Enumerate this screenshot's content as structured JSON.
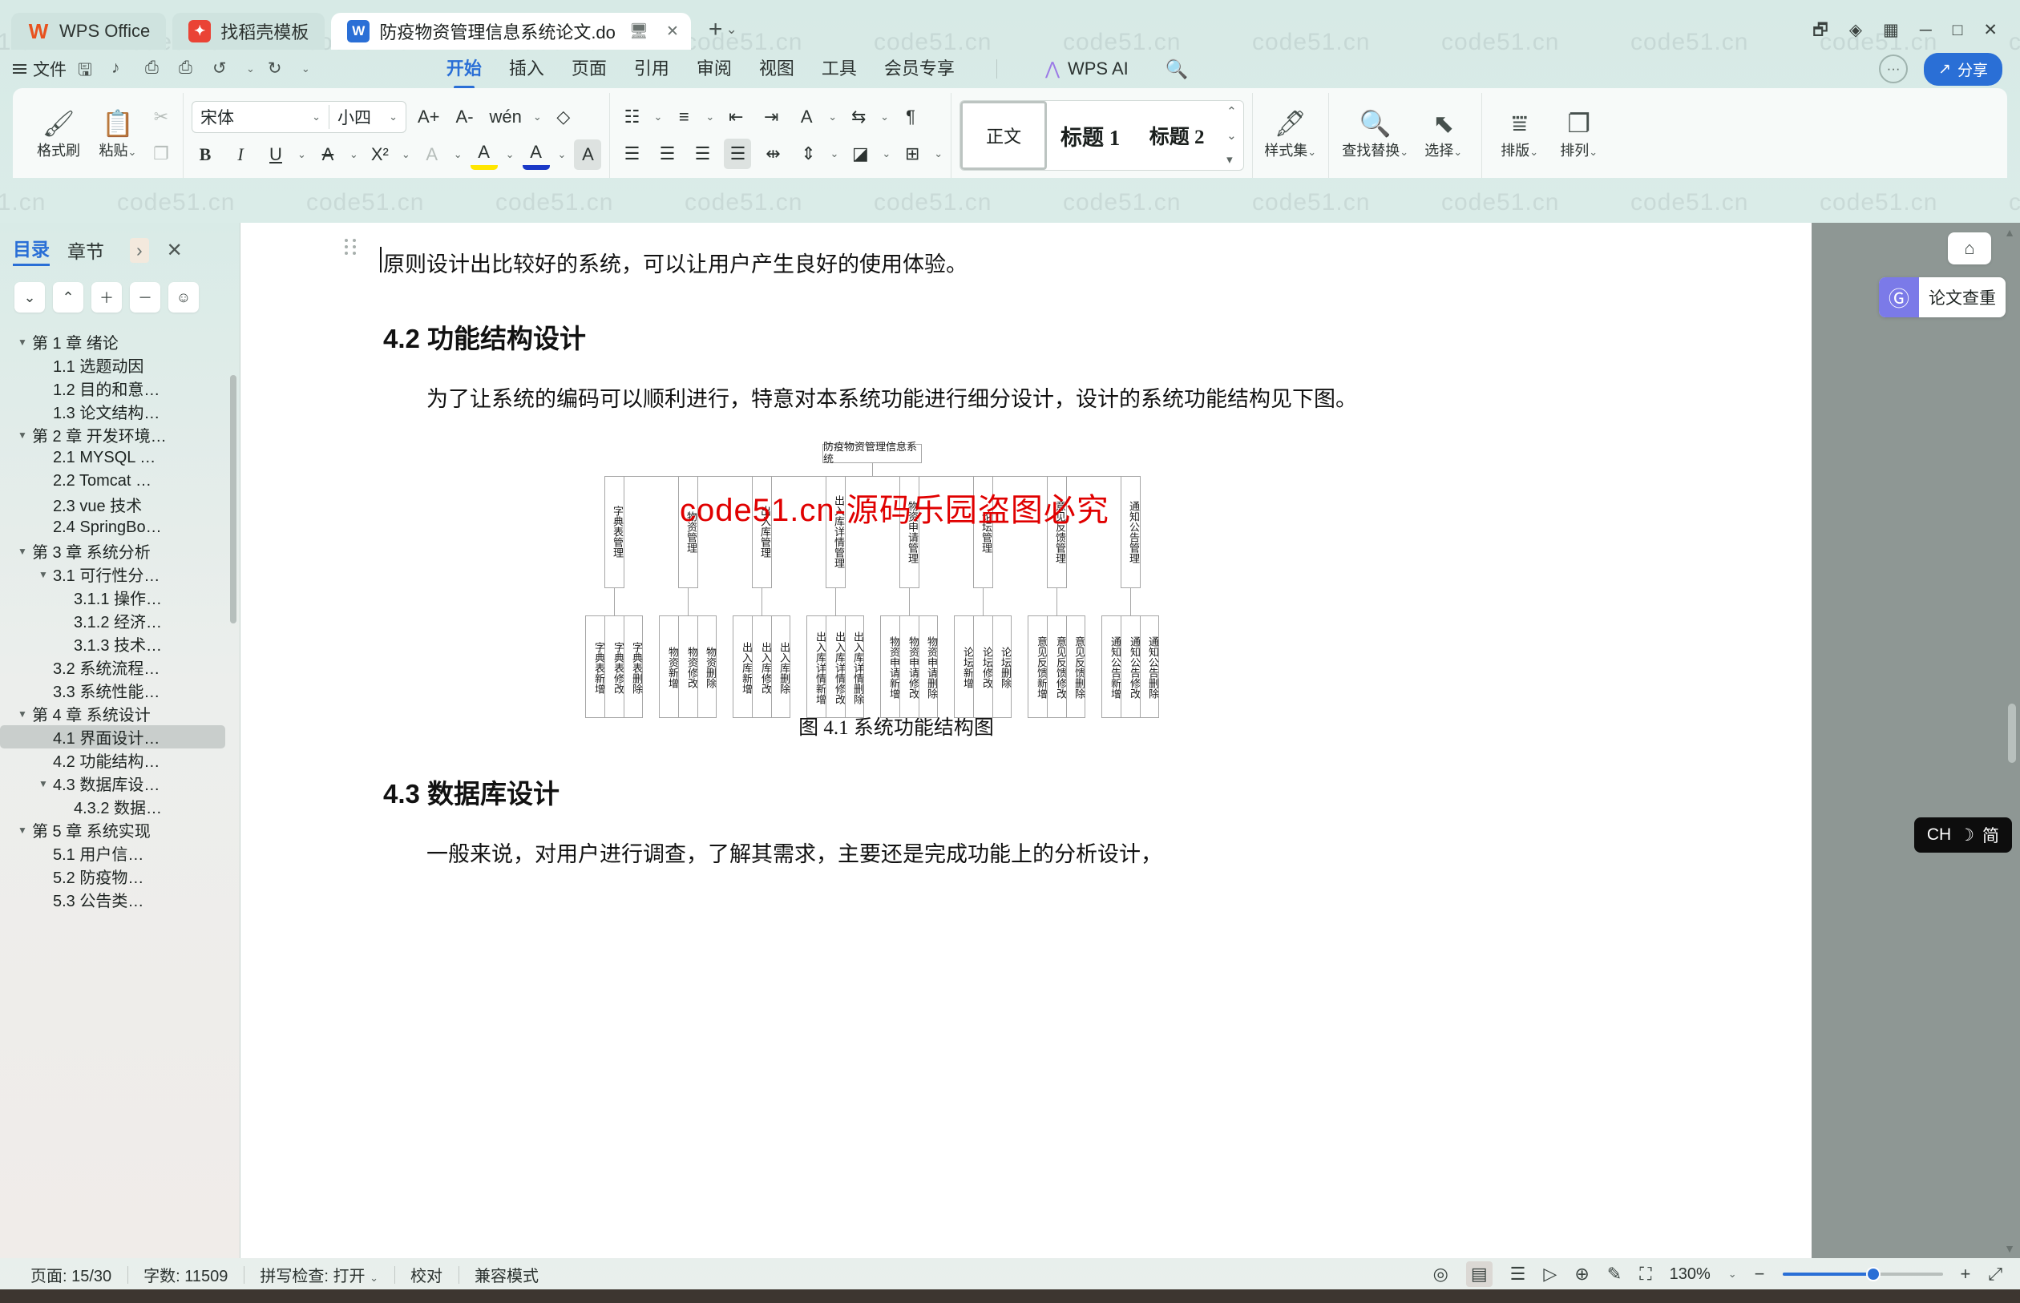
{
  "window": {
    "tabs": [
      {
        "label": "WPS Office",
        "icon": "wps-logo-icon",
        "active": false
      },
      {
        "label": "找稻壳模板",
        "icon": "template-icon",
        "active": false
      },
      {
        "label": "防疫物资管理信息系统论文.do",
        "icon": "word-doc-icon",
        "active": true
      }
    ],
    "new_tab_label": "+",
    "controls": [
      "restore-icon",
      "cloud-icon",
      "ad-icon",
      "minimize",
      "maximize",
      "close"
    ]
  },
  "menubar": {
    "file_label": "文件",
    "quick_icons": [
      "save-icon",
      "cloud-save-icon",
      "print-icon",
      "print-preview-icon",
      "undo-icon",
      "redo-icon",
      "customize-icon"
    ],
    "ribbon_tabs": [
      {
        "label": "开始",
        "selected": true
      },
      {
        "label": "插入",
        "selected": false
      },
      {
        "label": "页面",
        "selected": false
      },
      {
        "label": "引用",
        "selected": false
      },
      {
        "label": "审阅",
        "selected": false
      },
      {
        "label": "视图",
        "selected": false
      },
      {
        "label": "工具",
        "selected": false
      },
      {
        "label": "会员专享",
        "selected": false
      }
    ],
    "ai_label": "WPS AI",
    "search_icon": "search-icon",
    "help_icon": "help-icon",
    "share_label": "分享",
    "share_icon": "share-icon",
    "accent_color": "#2a6fd6"
  },
  "ribbon": {
    "clipboard": {
      "format_brush_label": "格式刷",
      "paste_label": "粘贴",
      "cut_icon": "scissors-icon",
      "copy_icon": "copy-icon"
    },
    "font": {
      "family_value": "宋体",
      "size_value": "小四",
      "grow_label": "A+",
      "shrink_label": "A-",
      "pinyin_label": "wén",
      "clear_format_icon": "eraser-icon",
      "bold_label": "B",
      "italic_label": "I",
      "underline_label": "U",
      "strikethrough_label": "A",
      "superscript_label": "X²",
      "char_border_label": "A",
      "highlight_label": "A",
      "highlight_color": "#ffe600",
      "font_color_label": "A",
      "font_color": "#1a39c7",
      "char_shading_label": "A"
    },
    "paragraph": {
      "bullets_icon": "bullet-list-icon",
      "numbering_icon": "numbered-list-icon",
      "outdent_icon": "decrease-indent-icon",
      "indent_icon": "increase-indent-icon",
      "sort_icon": "sort-icon",
      "showmarks_icon": "paragraph-marks-icon",
      "pinyin2_icon": "text-direction-icon",
      "align_left_icon": "align-left-icon",
      "align_center_icon": "align-center-icon",
      "align_right_icon": "align-right-icon",
      "align_justify_icon": "align-justify-icon",
      "distribute_icon": "distribute-icon",
      "line_spacing_icon": "line-spacing-icon",
      "shading_icon": "shading-icon",
      "borders_icon": "borders-icon"
    },
    "styles": {
      "items": [
        {
          "label": "正文",
          "selected": true
        },
        {
          "label": "标题 1",
          "selected": false
        },
        {
          "label": "标题 2",
          "selected": false
        }
      ],
      "gallery_label": "样式集"
    },
    "editing": {
      "find_replace_label": "查找替换",
      "select_label": "选择",
      "typeset_label": "排版",
      "arrange_label": "排列"
    }
  },
  "sidebar": {
    "tabs": [
      {
        "label": "目录",
        "selected": true
      },
      {
        "label": "章节",
        "selected": false
      }
    ],
    "expand_icon": "chevron-right-icon",
    "close_icon": "close-icon",
    "tools": [
      "collapse-down-icon",
      "collapse-up-icon",
      "plus-icon",
      "minus-icon",
      "settings-icon"
    ],
    "tree": [
      {
        "label": "第 1 章 绪论",
        "level": 0,
        "twisty": "▼",
        "selected": false
      },
      {
        "label": "1.1 选题动因",
        "level": 1,
        "twisty": "",
        "selected": false
      },
      {
        "label": "1.2 目的和意…",
        "level": 1,
        "twisty": "",
        "selected": false
      },
      {
        "label": "1.3 论文结构…",
        "level": 1,
        "twisty": "",
        "selected": false
      },
      {
        "label": "第 2 章 开发环境…",
        "level": 0,
        "twisty": "▼",
        "selected": false
      },
      {
        "label": "2.1 MYSQL …",
        "level": 1,
        "twisty": "",
        "selected": false
      },
      {
        "label": "2.2 Tomcat …",
        "level": 1,
        "twisty": "",
        "selected": false
      },
      {
        "label": "2.3 vue 技术",
        "level": 1,
        "twisty": "",
        "selected": false
      },
      {
        "label": "2.4 SpringBo…",
        "level": 1,
        "twisty": "",
        "selected": false
      },
      {
        "label": "第 3 章 系统分析",
        "level": 0,
        "twisty": "▼",
        "selected": false
      },
      {
        "label": "3.1 可行性分…",
        "level": 1,
        "twisty": "▼",
        "selected": false
      },
      {
        "label": "3.1.1 操作…",
        "level": 2,
        "twisty": "",
        "selected": false
      },
      {
        "label": "3.1.2 经济…",
        "level": 2,
        "twisty": "",
        "selected": false
      },
      {
        "label": "3.1.3 技术…",
        "level": 2,
        "twisty": "",
        "selected": false
      },
      {
        "label": "3.2 系统流程…",
        "level": 1,
        "twisty": "",
        "selected": false
      },
      {
        "label": "3.3 系统性能…",
        "level": 1,
        "twisty": "",
        "selected": false
      },
      {
        "label": "第 4 章 系统设计",
        "level": 0,
        "twisty": "▼",
        "selected": false
      },
      {
        "label": "4.1 界面设计…",
        "level": 1,
        "twisty": "",
        "selected": true
      },
      {
        "label": "4.2 功能结构…",
        "level": 1,
        "twisty": "",
        "selected": false
      },
      {
        "label": "4.3 数据库设…",
        "level": 1,
        "twisty": "▼",
        "selected": false
      },
      {
        "label": "4.3.2 数据…",
        "level": 2,
        "twisty": "",
        "selected": false
      },
      {
        "label": "第 5 章 系统实现",
        "level": 0,
        "twisty": "▼",
        "selected": false
      },
      {
        "label": "5.1 用户信…",
        "level": 1,
        "twisty": "",
        "selected": false
      },
      {
        "label": "5.2 防疫物…",
        "level": 1,
        "twisty": "",
        "selected": false
      },
      {
        "label": "5.3 公告类…",
        "level": 1,
        "twisty": "",
        "selected": false
      }
    ]
  },
  "document": {
    "para_top": "原则设计出比较好的系统，可以让用户产生良好的使用体验。",
    "heading_42": "4.2 功能结构设计",
    "para_42": "为了让系统的编码可以顺利进行，特意对本系统功能进行细分设计，设计的系统功能结构见下图。",
    "figure_caption": "图 4.1  系统功能结构图",
    "heading_43": "4.3 数据库设计",
    "para_43": "一般来说，对用户进行调查，了解其需求，主要还是完成功能上的分析设计，",
    "red_watermark": "code51.cn-源码乐园盗图必究",
    "page_watermark": "code51.cn"
  },
  "diagram": {
    "root": "防疫物资管理信息系统",
    "branches": [
      {
        "label": "字典表管理",
        "leaves": [
          "字典表新增",
          "字典表修改",
          "字典表删除"
        ]
      },
      {
        "label": "物资管理",
        "leaves": [
          "物资新增",
          "物资修改",
          "物资删除"
        ]
      },
      {
        "label": "出入库管理",
        "leaves": [
          "出入库新增",
          "出入库修改",
          "出入库删除"
        ]
      },
      {
        "label": "出入库详情管理",
        "leaves": [
          "出入库详情新增",
          "出入库详情修改",
          "出入库详情删除"
        ]
      },
      {
        "label": "物资申请管理",
        "leaves": [
          "物资申请新增",
          "物资申请修改",
          "物资申请删除"
        ]
      },
      {
        "label": "论坛管理",
        "leaves": [
          "论坛新增",
          "论坛修改",
          "论坛删除"
        ]
      },
      {
        "label": "意见反馈管理",
        "leaves": [
          "意见反馈新增",
          "意见反馈修改",
          "意见反馈删除"
        ]
      },
      {
        "label": "通知公告管理",
        "leaves": [
          "通知公告新增",
          "通知公告修改",
          "通知公告删除"
        ]
      }
    ]
  },
  "right_rail": {
    "collapse_icon": "collapse-panel-icon",
    "paper_check_label": "论文查重",
    "paper_check_icon": "plagiarism-check-icon",
    "ime": {
      "lang": "CH",
      "mode_icon": "moon-icon",
      "simplified": "简"
    }
  },
  "statusbar": {
    "page_label": "页面: 15/30",
    "word_count_label": "字数: 11509",
    "spellcheck_label": "拼写检查: 打开",
    "proofread_label": "校对",
    "compat_label": "兼容模式",
    "view_icons": [
      "focus-mode-icon",
      "page-view-icon",
      "outline-view-icon",
      "play-icon",
      "web-view-icon",
      "pen-icon",
      "fullscreen-icon"
    ],
    "zoom_value": "130%",
    "zoom_minus": "−",
    "zoom_plus": "+",
    "expand_icon": "expand-icon"
  }
}
